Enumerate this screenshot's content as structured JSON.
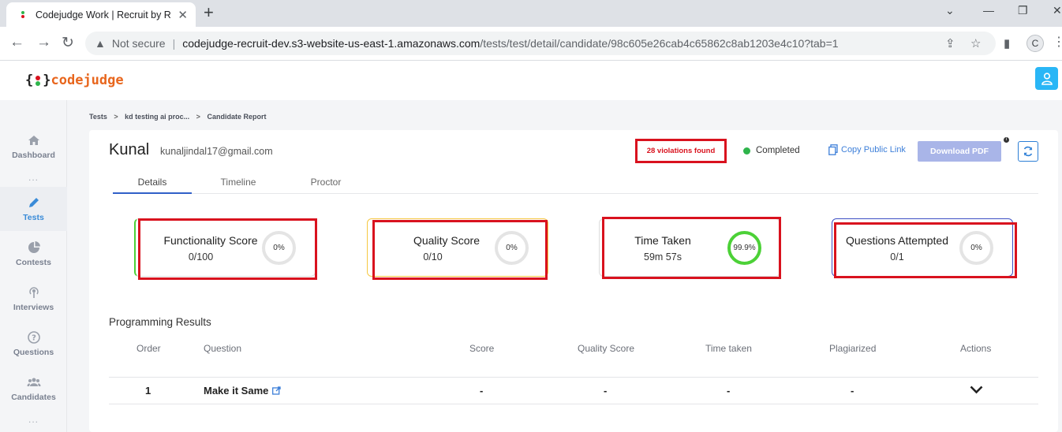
{
  "browser": {
    "tab_title": "Codejudge Work | Recruit by Real",
    "security_label": "Not secure",
    "url_host": "codejudge-recruit-dev.s3-website-us-east-1.amazonaws.com",
    "url_path": "/tests/test/detail/candidate/98c605e26cab4c65862c8ab1203e4c10?tab=1",
    "profile_initial": "C"
  },
  "app": {
    "logo_open": "{",
    "logo_close": "}",
    "logo_word": "codejudge"
  },
  "sidebar": {
    "items": [
      {
        "label": "Dashboard",
        "icon": "home-icon"
      },
      {
        "label": "Tests",
        "icon": "pencil-icon"
      },
      {
        "label": "Contests",
        "icon": "pie-chart-icon"
      },
      {
        "label": "Interviews",
        "icon": "broadcast-icon"
      },
      {
        "label": "Questions",
        "icon": "question-icon"
      },
      {
        "label": "Candidates",
        "icon": "users-icon"
      }
    ],
    "dots": "..."
  },
  "breadcrumb": {
    "items": [
      "Tests",
      "kd testing ai proc...",
      "Candidate Report"
    ],
    "separator": ">"
  },
  "candidate": {
    "name": "Kunal",
    "email": "kunaljindal17@gmail.com",
    "violations": "28 violations found",
    "status": "Completed",
    "copy_link": "Copy Public Link",
    "download_pdf": "Download PDF",
    "info": "i"
  },
  "tabs": [
    "Details",
    "Timeline",
    "Proctor"
  ],
  "metrics": [
    {
      "title": "Functionality Score",
      "value": "0/100",
      "percent": "0%",
      "accent": "#4cd137"
    },
    {
      "title": "Quality Score",
      "value": "0/10",
      "percent": "0%",
      "accent": "#f5b800"
    },
    {
      "title": "Time Taken",
      "value": "59m 57s",
      "percent": "99.9%",
      "accent": "#cccccc"
    },
    {
      "title": "Questions Attempted",
      "value": "0/1",
      "percent": "0%",
      "accent": "#3d4fc4"
    }
  ],
  "programming": {
    "title": "Programming Results",
    "headers": [
      "Order",
      "Question",
      "Score",
      "Quality Score",
      "Time taken",
      "Plagiarized",
      "Actions"
    ],
    "rows": [
      {
        "order": "1",
        "question": "Make it Same",
        "score": "-",
        "quality": "-",
        "time": "-",
        "plagiarized": "-"
      }
    ]
  },
  "colors": {
    "accent_blue": "#29b6f6",
    "violation_red": "#d9121e",
    "status_green": "#2eb44b",
    "logo_orange": "#e8661d"
  }
}
